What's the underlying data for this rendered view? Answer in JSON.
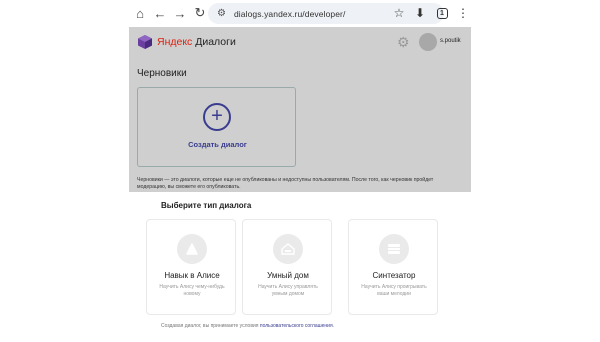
{
  "browser": {
    "icons": [
      "home-icon",
      "back-icon",
      "forward-icon",
      "reload-icon",
      "tune-icon",
      "star-icon",
      "download-icon",
      "tabs-icon",
      "menu-icon"
    ],
    "url": "dialogs.yandex.ru/developer/",
    "tab_count": "1"
  },
  "app": {
    "logo_brand": "Яндекс",
    "logo_product": " Диалоги",
    "username": "s.poutik",
    "drafts_title": "Черновики",
    "create_label": "Создать диалог",
    "drafts_note": "Черновики — это диалоги, которые еще не опубликованы и недоступны пользователям. После того, как черновик пройдет модерацию, вы сможете его опубликовать."
  },
  "modal": {
    "title": "Выберите тип диалога",
    "types": [
      {
        "name": "Навык в Алисе",
        "desc": "Научить Алису чему-нибудь новому",
        "icon": "alice-icon"
      },
      {
        "name": "Умный дом",
        "desc": "Научить Алису управлять умным домом",
        "icon": "smart-home-icon"
      },
      {
        "name": "Синтезатор",
        "desc": "Научить Алису проигрывать ваши мелодии",
        "icon": "synthesizer-icon"
      }
    ],
    "agreement_prefix": "Создавая диалог, вы принимаете условия ",
    "agreement_link": "пользовательского соглашения",
    "agreement_suffix": "."
  },
  "colors": {
    "accent": "#3a3d8f",
    "overlay": "#cfcfcf",
    "logo_red": "#dd2211"
  }
}
